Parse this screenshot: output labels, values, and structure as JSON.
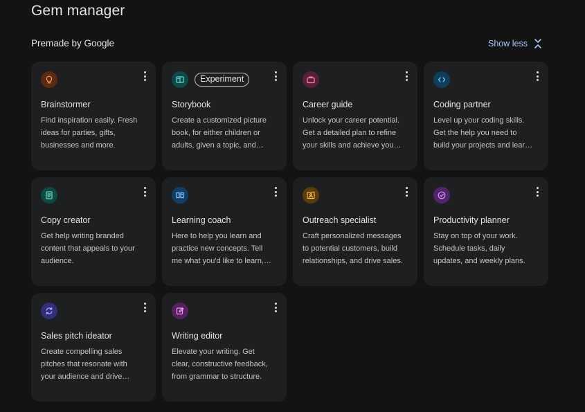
{
  "page_title": "Gem manager",
  "section": {
    "title": "Premade by Google",
    "toggle_label": "Show less"
  },
  "gems": [
    {
      "title": "Brainstormer",
      "description": "Find inspiration easily. Fresh ideas for parties, gifts, businesses and more.",
      "icon": "lightbulb-icon",
      "icon_bg": "#5c2a10",
      "icon_color": "#f29d63",
      "badge": ""
    },
    {
      "title": "Storybook",
      "description": "Create a customized picture book, for either children or adults, given a topic, and more.",
      "icon": "book-icon",
      "icon_bg": "#0f4a4a",
      "icon_color": "#6fd6d0",
      "badge": "Experiment"
    },
    {
      "title": "Career guide",
      "description": "Unlock your career potential. Get a detailed plan to refine your skills and achieve your goals.",
      "icon": "briefcase-icon",
      "icon_bg": "#5a1f38",
      "icon_color": "#f28bb4",
      "badge": ""
    },
    {
      "title": "Coding partner",
      "description": "Level up your coding skills. Get the help you need to build your projects and learn more.",
      "icon": "code-icon",
      "icon_bg": "#0d3e5a",
      "icon_color": "#7ccfff",
      "badge": ""
    },
    {
      "title": "Copy creator",
      "description": "Get help writing branded content that appeals to your audience.",
      "icon": "document-icon",
      "icon_bg": "#0d4a40",
      "icon_color": "#6fdcc4",
      "badge": ""
    },
    {
      "title": "Learning coach",
      "description": "Here to help you learn and practice new concepts. Tell me what you'd like to learn, and more.",
      "icon": "open-book-icon",
      "icon_bg": "#123f66",
      "icon_color": "#8ec5ff",
      "badge": ""
    },
    {
      "title": "Outreach specialist",
      "description": "Craft personalized messages to potential customers, build relationships, and drive sales.",
      "icon": "contact-card-icon",
      "icon_bg": "#5a3d0a",
      "icon_color": "#f5b84a",
      "badge": ""
    },
    {
      "title": "Productivity planner",
      "description": "Stay on top of your work. Schedule tasks, daily updates, and weekly plans.",
      "icon": "check-circle-icon",
      "icon_bg": "#51246b",
      "icon_color": "#d59cf5",
      "badge": ""
    },
    {
      "title": "Sales pitch ideator",
      "description": "Create compelling sales pitches that resonate with your audience and drive results.",
      "icon": "refresh-icon",
      "icon_bg": "#332e7a",
      "icon_color": "#b3adff",
      "badge": ""
    },
    {
      "title": "Writing editor",
      "description": "Elevate your writing. Get clear, constructive feedback, from grammar to structure.",
      "icon": "edit-icon",
      "icon_bg": "#56205e",
      "icon_color": "#e79cf0",
      "badge": ""
    }
  ]
}
